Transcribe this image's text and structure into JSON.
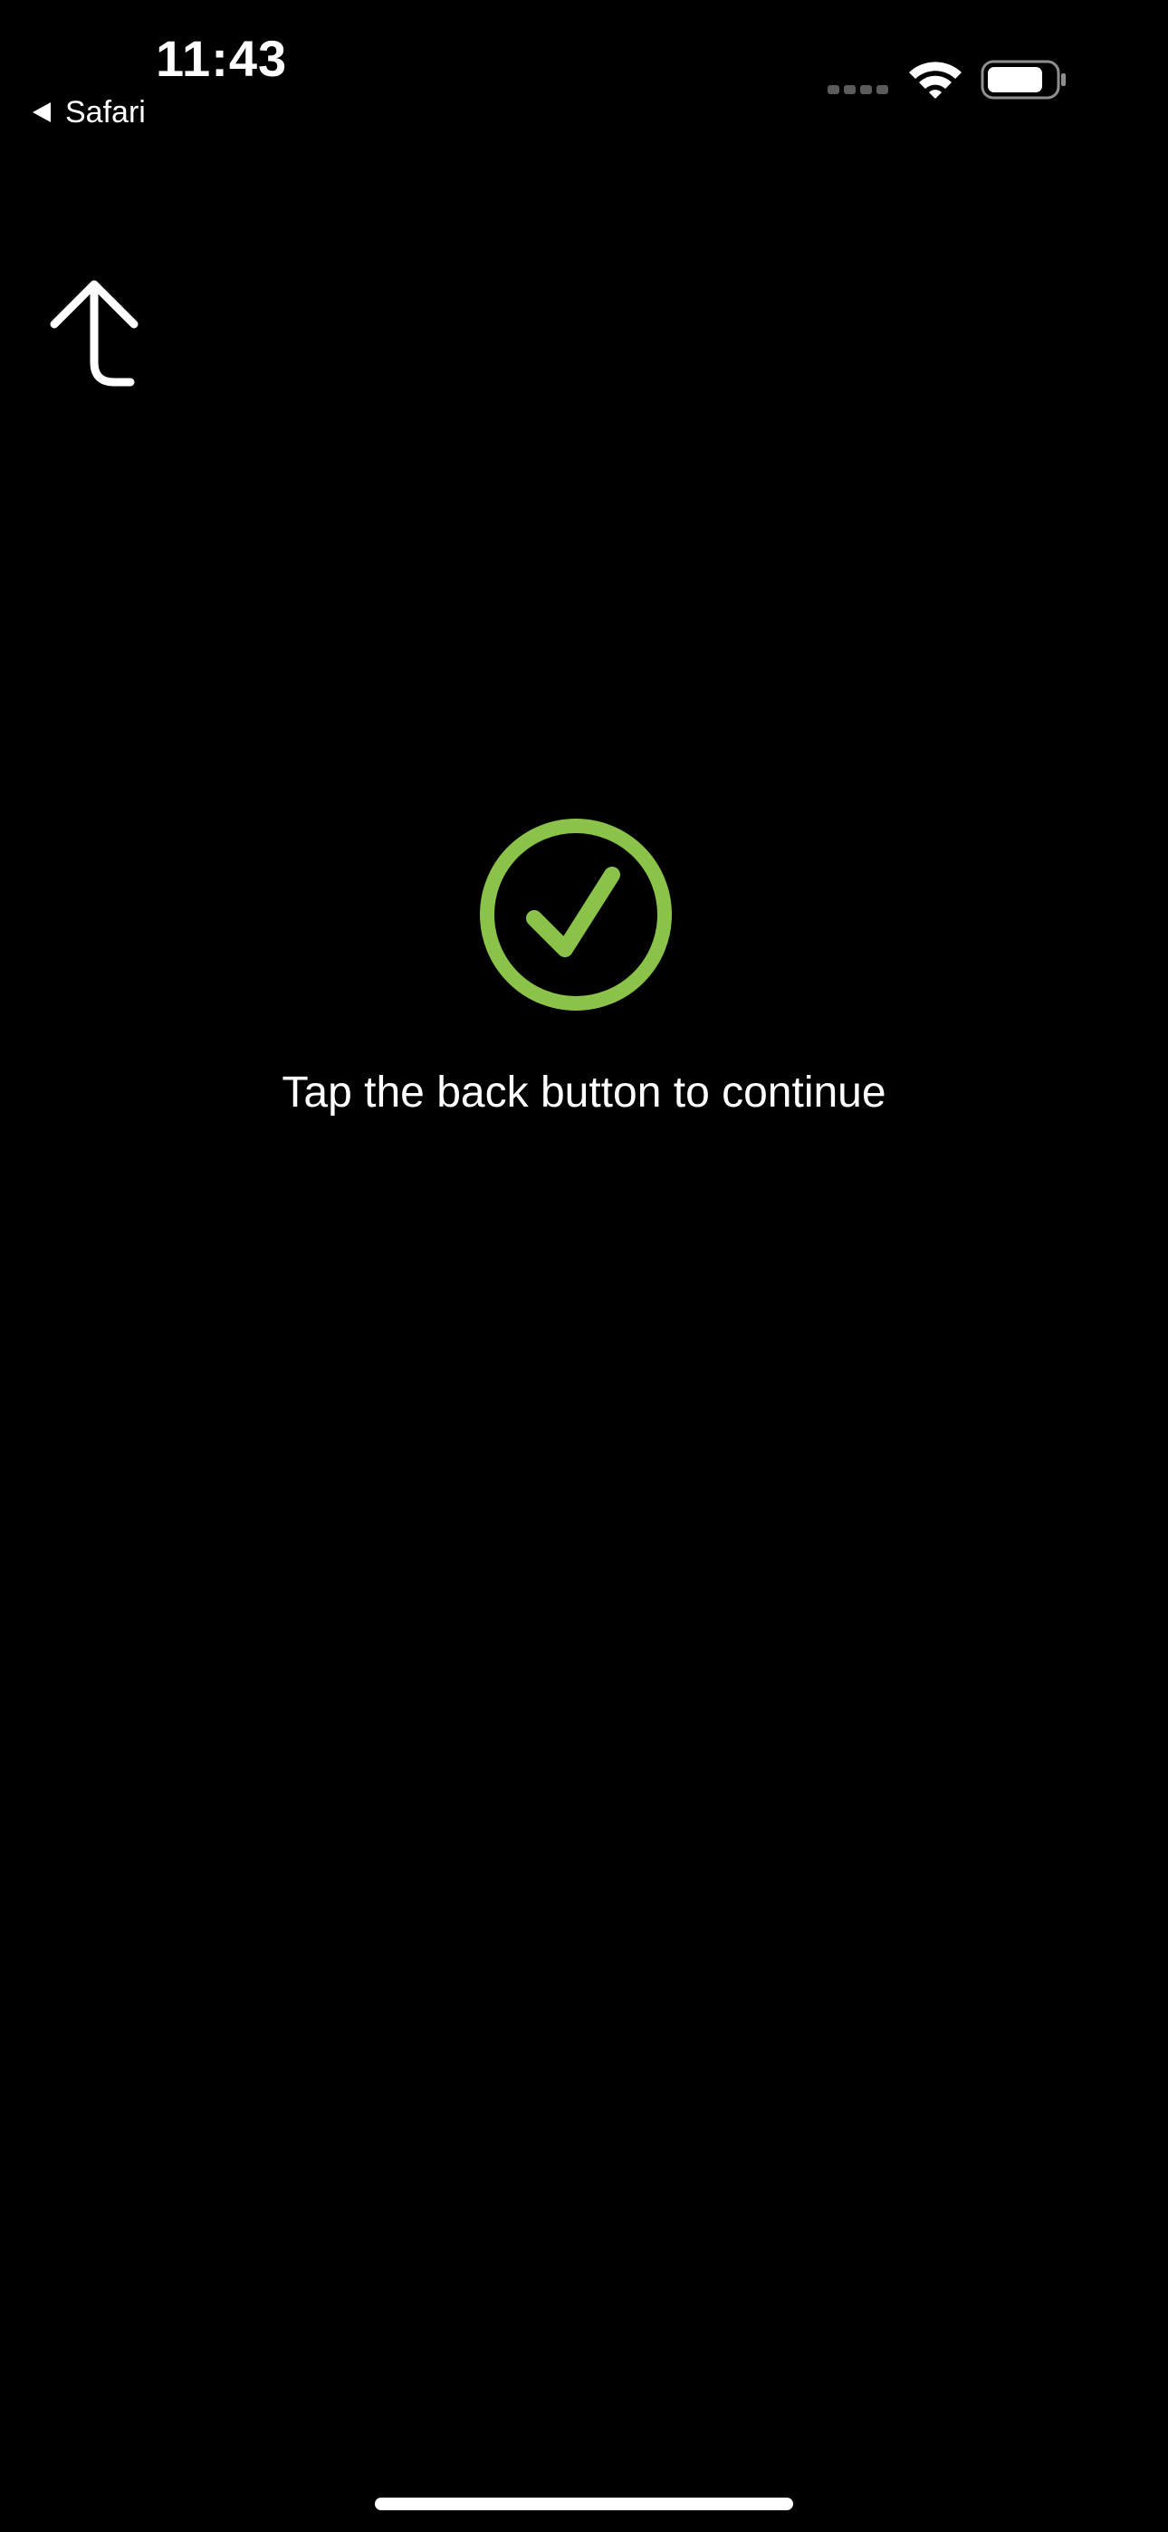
{
  "status_bar": {
    "time": "11:43",
    "back_app_label": "Safari",
    "icons": [
      "cellular-signal-icon",
      "wifi-icon",
      "battery-icon"
    ]
  },
  "nav": {
    "back_icon": "curved-up-arrow-icon"
  },
  "main": {
    "success_icon": "check-circle-icon",
    "message": "Tap the back button to continue"
  },
  "colors": {
    "background": "#000000",
    "text": "#ffffff",
    "success": "#8bc34a"
  }
}
